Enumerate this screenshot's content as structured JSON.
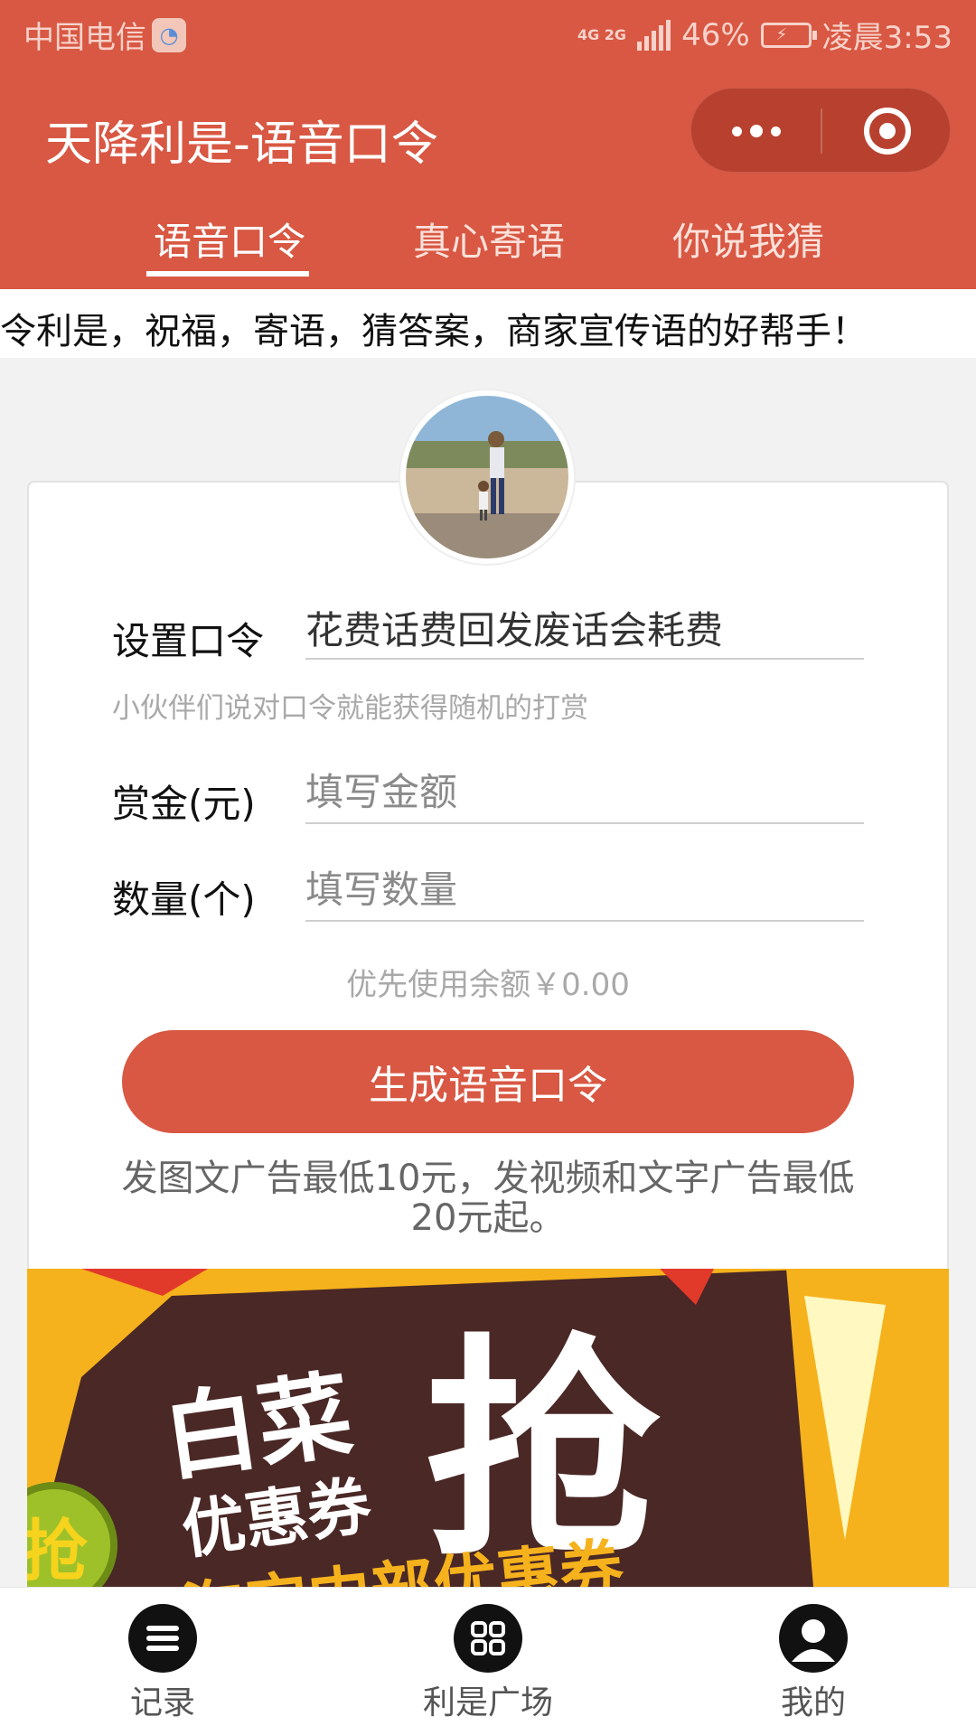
{
  "status_bar": {
    "carrier": "中国电信",
    "network": "4G 2G",
    "battery": "46%",
    "time": "凌晨3:53"
  },
  "nav": {
    "title": "天降利是-语音口令",
    "icons": [
      "more-icon",
      "target-icon"
    ]
  },
  "tabs": [
    {
      "label": "语音口令",
      "active": true
    },
    {
      "label": "真心寄语",
      "active": false
    },
    {
      "label": "你说我猜",
      "active": false
    }
  ],
  "marquee": "令利是，祝福，寄语，猜答案，商家宣传语的好帮手！",
  "form": {
    "password_label": "设置口令",
    "password_value": "花费话费回发废话会耗费",
    "password_hint": "小伙伴们说对口令就能获得随机的打赏",
    "amount_label": "赏金(元)",
    "amount_placeholder": "填写金额",
    "quantity_label": "数量(个)",
    "quantity_placeholder": "填写数量",
    "balance_text": "优先使用余额￥0.00",
    "submit_label": "生成语音口令",
    "note": "发图文广告最低10元，发视频和文字广告最低20元起。"
  },
  "banner": {
    "text1": "白菜",
    "text2": "优惠券",
    "text3": "抢",
    "text4": "淘宝内部优惠券",
    "badge": "抢"
  },
  "bottom_nav": [
    {
      "label": "记录",
      "icon": "list-icon"
    },
    {
      "label": "利是广场",
      "icon": "grid-icon"
    },
    {
      "label": "我的",
      "icon": "user-icon"
    }
  ],
  "colors": {
    "brand": "#d85843",
    "capsule": "#b8402f",
    "banner": "#f6b21c"
  }
}
